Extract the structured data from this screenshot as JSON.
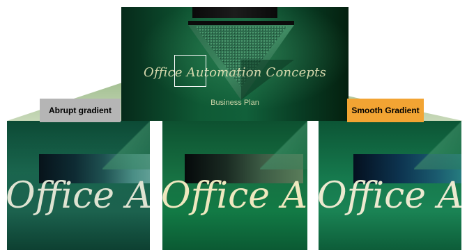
{
  "slide": {
    "title": "Office Automation Concepts",
    "subtitle": "Business Plan"
  },
  "panels": [
    {
      "text": "Office Au",
      "label": "Abrupt gradient"
    },
    {
      "text": "Office Au",
      "label": ""
    },
    {
      "text": "Office Au",
      "label": "Smooth Gradient"
    }
  ],
  "colors": {
    "callout": "#9cb98a",
    "abrupt_label_bg": "#b5b5b5",
    "smooth_label_bg": "#f2a433"
  }
}
